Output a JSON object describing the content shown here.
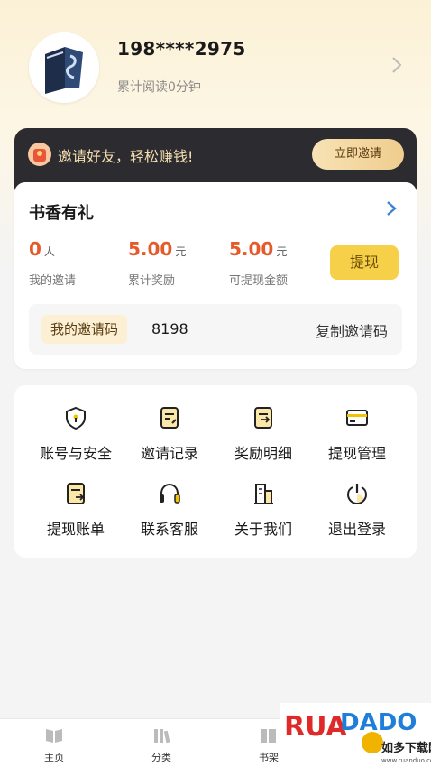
{
  "profile": {
    "phone": "198****2975",
    "read_time": "累计阅读0分钟"
  },
  "invite_banner": {
    "text": "邀请好友，轻松赚钱!",
    "button": "立即邀请"
  },
  "reward": {
    "title": "书香有礼",
    "stats": [
      {
        "value": "0",
        "unit": "人",
        "label": "我的邀请"
      },
      {
        "value": "5.00",
        "unit": "元",
        "label": "累计奖励"
      },
      {
        "value": "5.00",
        "unit": "元",
        "label": "可提现金额"
      }
    ],
    "withdraw_button": "提现",
    "code_label": "我的邀请码",
    "code_value": "8198",
    "copy_label": "复制邀请码"
  },
  "menu": [
    {
      "label": "账号与安全",
      "icon": "shield-icon"
    },
    {
      "label": "邀请记录",
      "icon": "invite-record-icon"
    },
    {
      "label": "奖励明细",
      "icon": "reward-detail-icon"
    },
    {
      "label": "提现管理",
      "icon": "card-icon"
    },
    {
      "label": "提现账单",
      "icon": "bill-icon"
    },
    {
      "label": "联系客服",
      "icon": "headset-icon"
    },
    {
      "label": "关于我们",
      "icon": "building-icon"
    },
    {
      "label": "退出登录",
      "icon": "power-icon"
    }
  ],
  "nav": [
    {
      "label": "主页",
      "icon": "book-icon"
    },
    {
      "label": "分类",
      "icon": "category-icon"
    },
    {
      "label": "书架",
      "icon": "shelf-icon"
    }
  ],
  "watermark": {
    "logo": "RUANDUO",
    "subtitle": "如多下载网",
    "url": "www.ruanduo.com"
  },
  "colors": {
    "accent": "#e55a2b",
    "button_yellow": "#f7d04a",
    "banner_dark": "#2c2c30",
    "gold": "#f5dfb0"
  }
}
